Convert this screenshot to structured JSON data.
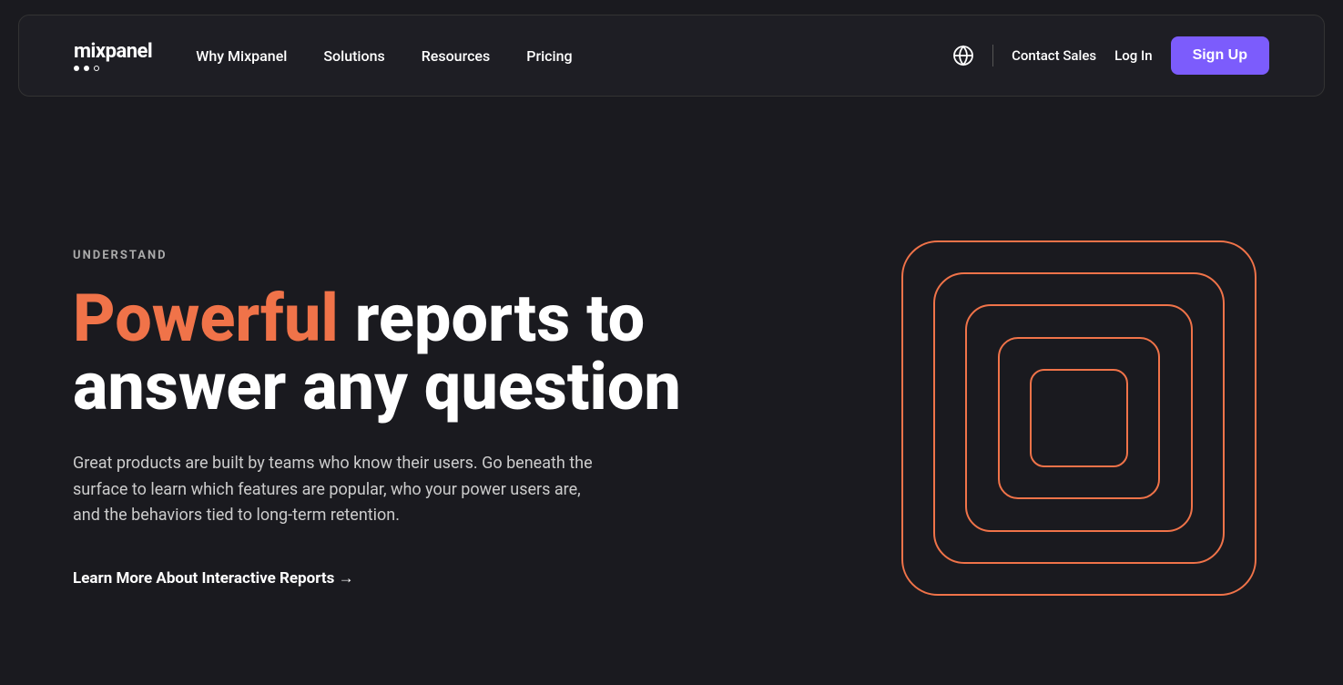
{
  "nav": {
    "logo_text": "mixpanel",
    "links": [
      {
        "label": "Why Mixpanel",
        "id": "why-mixpanel"
      },
      {
        "label": "Solutions",
        "id": "solutions"
      },
      {
        "label": "Resources",
        "id": "resources"
      },
      {
        "label": "Pricing",
        "id": "pricing"
      }
    ],
    "contact_sales": "Contact Sales",
    "login": "Log In",
    "signup": "Sign Up"
  },
  "hero": {
    "section_label": "UNDERSTAND",
    "headline_accent": "Powerful",
    "headline_rest": " reports to answer any question",
    "description": "Great products are built by teams who know their users. Go beneath the surface to learn which features are popular, who your power users are, and the behaviors tied to long-term retention.",
    "cta_link": "Learn More About Interactive Reports →"
  },
  "colors": {
    "accent": "#f07349",
    "cta_bg": "#7c5cfc",
    "nav_border": "#333333",
    "bg": "#1a1a1f"
  }
}
